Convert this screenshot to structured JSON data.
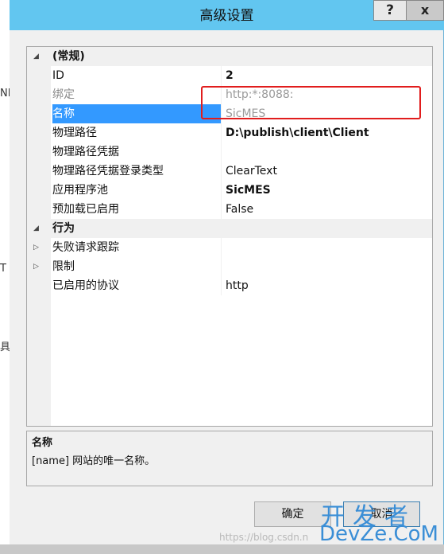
{
  "dialog": {
    "title": "高级设置",
    "help_glyph": "?",
    "close_glyph": "x"
  },
  "background": {
    "glyphs": [
      "NE",
      "T",
      "具"
    ]
  },
  "grid": {
    "categories": [
      {
        "label": "(常规)",
        "expander": "◢"
      },
      {
        "label": "行为",
        "expander": "◢"
      }
    ],
    "rows": [
      {
        "name": "ID",
        "value": "2"
      },
      {
        "name": "绑定",
        "value": "http:*:8088:"
      },
      {
        "name": "名称",
        "value": "SicMES"
      },
      {
        "name": "物理路径",
        "value": "D:\\publish\\client\\Client"
      },
      {
        "name": "物理路径凭据",
        "value": ""
      },
      {
        "name": "物理路径凭据登录类型",
        "value": "ClearText"
      },
      {
        "name": "应用程序池",
        "value": "SicMES"
      },
      {
        "name": "预加载已启用",
        "value": "False"
      },
      {
        "name": "失败请求跟踪",
        "value": "",
        "expander": "▷"
      },
      {
        "name": "限制",
        "value": "",
        "expander": "▷"
      },
      {
        "name": "已启用的协议",
        "value": "http"
      }
    ]
  },
  "description": {
    "title": "名称",
    "text": "[name] 网站的唯一名称。"
  },
  "buttons": {
    "ok": "确定",
    "cancel": "取消"
  },
  "watermark": {
    "url": "https://blog.csdn.n",
    "top": "开发者",
    "bottom": "DevZe.CoM"
  },
  "colors": {
    "title_bar": "#62c6f0",
    "selection": "#3399ff",
    "highlight": "#e11d1d",
    "watermark": "#3a8ed6"
  }
}
